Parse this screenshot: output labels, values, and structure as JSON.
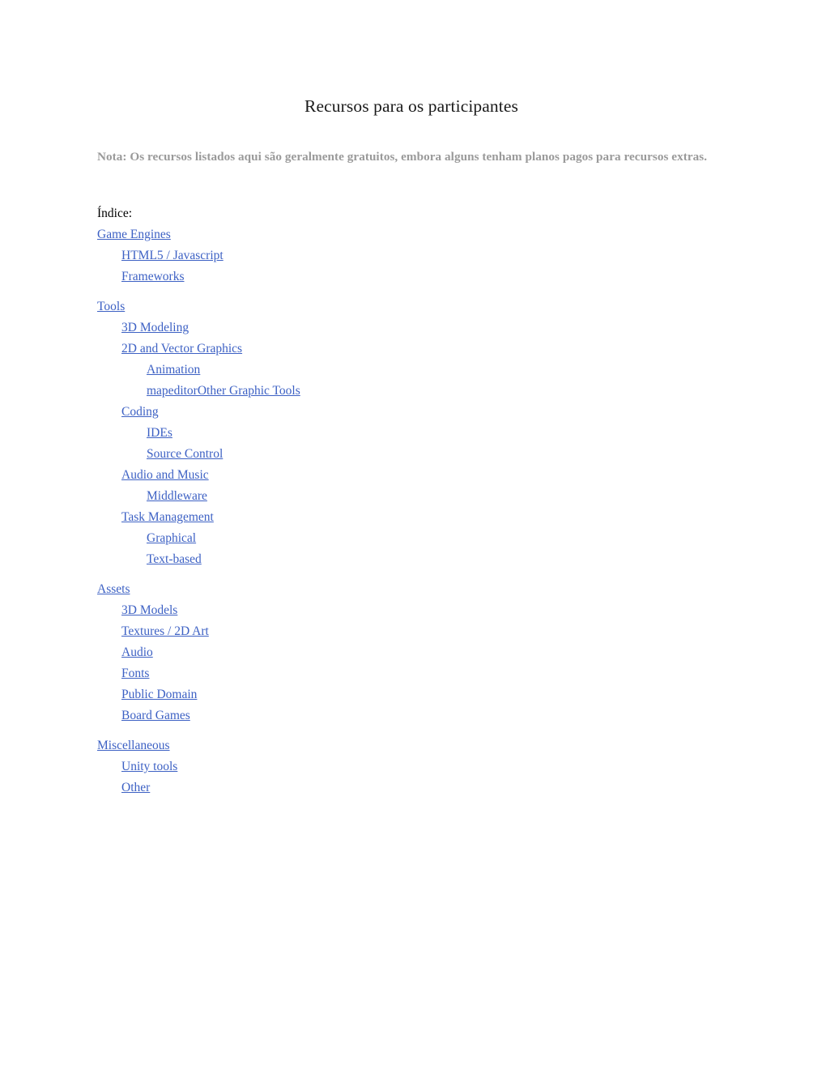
{
  "document": {
    "title": "Recursos para os participantes",
    "note": "Nota: Os recursos listados aqui são geralmente gratuitos, embora alguns tenham planos pagos para recursos extras.",
    "index_label": "Índice:",
    "link_color": "#3d61c4",
    "note_color": "#9a9a9a",
    "title_color": "#1a1a1a",
    "background_color": "#ffffff"
  },
  "toc": {
    "groups": [
      {
        "items": [
          {
            "label": "Game Engines",
            "level": 0
          },
          {
            "label": "HTML5 / Javascript",
            "level": 1
          },
          {
            "label": "Frameworks",
            "level": 1
          }
        ]
      },
      {
        "items": [
          {
            "label": "Tools",
            "level": 0
          },
          {
            "label": "3D Modeling",
            "level": 1
          },
          {
            "label": "2D and Vector Graphics",
            "level": 1
          },
          {
            "label": "Animation",
            "level": 2
          },
          {
            "label": "mapeditorOther Graphic Tools",
            "level": 2
          },
          {
            "label": "Coding",
            "level": 1
          },
          {
            "label": "IDEs",
            "level": 2
          },
          {
            "label": "Source Control",
            "level": 2
          },
          {
            "label": "Audio and Music",
            "level": 1
          },
          {
            "label": "Middleware",
            "level": 2
          },
          {
            "label": "Task Management",
            "level": 1
          },
          {
            "label": "Graphical",
            "level": 2
          },
          {
            "label": "Text-based",
            "level": 2
          }
        ]
      },
      {
        "items": [
          {
            "label": "Assets",
            "level": 0
          },
          {
            "label": "3D Models",
            "level": 1
          },
          {
            "label": "Textures / 2D Art",
            "level": 1
          },
          {
            "label": "Audio",
            "level": 1
          },
          {
            "label": "Fonts",
            "level": 1
          },
          {
            "label": "Public Domain",
            "level": 1
          },
          {
            "label": "Board Games",
            "level": 1
          }
        ]
      },
      {
        "items": [
          {
            "label": "Miscellaneous",
            "level": 0
          },
          {
            "label": "Unity tools",
            "level": 1
          },
          {
            "label": "Other",
            "level": 1
          }
        ]
      }
    ]
  }
}
